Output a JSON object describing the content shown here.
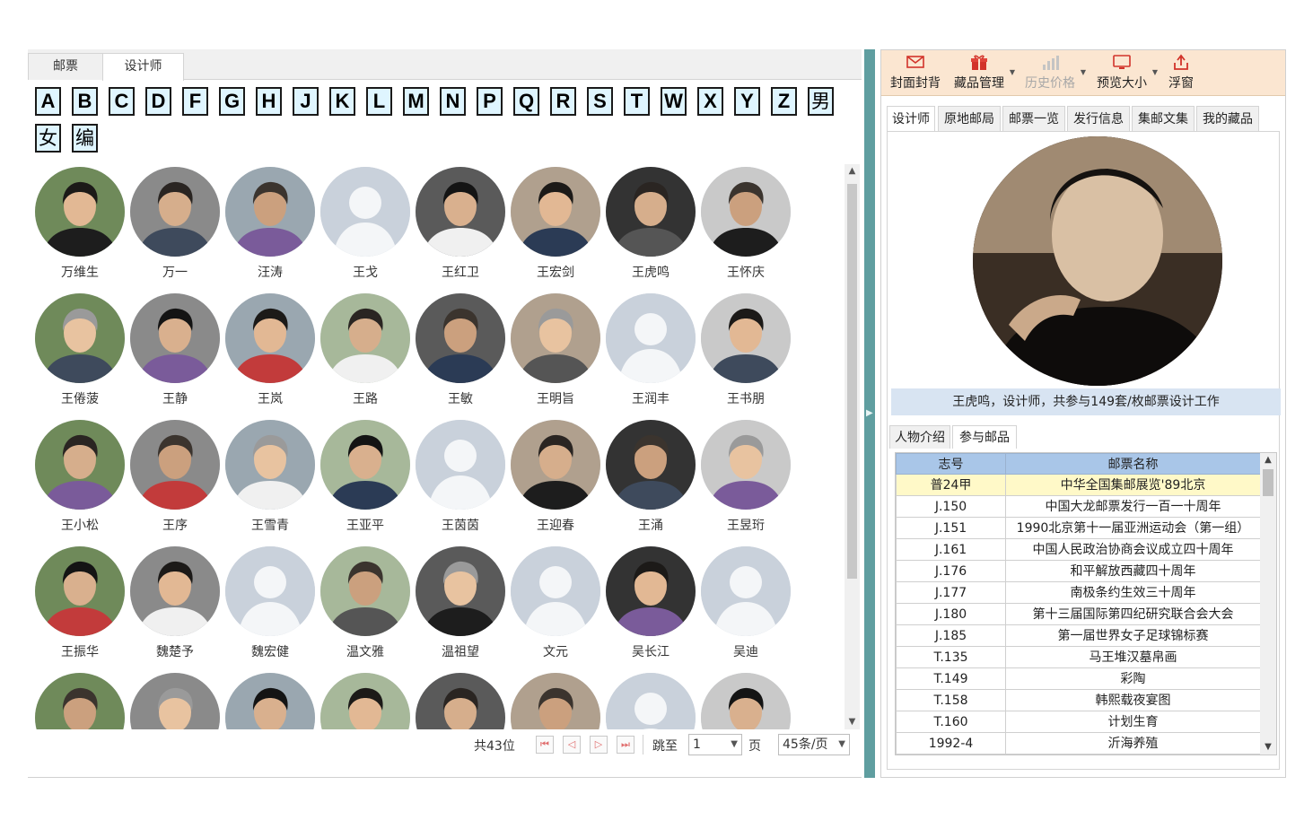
{
  "left_tabs": [
    {
      "label": "邮票"
    },
    {
      "label": "设计师"
    }
  ],
  "letters": [
    "A",
    "B",
    "C",
    "D",
    "F",
    "G",
    "H",
    "J",
    "K",
    "L",
    "M",
    "N",
    "P",
    "Q",
    "R",
    "S",
    "T",
    "W",
    "X",
    "Y",
    "Z",
    "男",
    "女",
    "编"
  ],
  "designers": [
    {
      "name": "万维生",
      "photo": true
    },
    {
      "name": "万一",
      "photo": true
    },
    {
      "name": "汪涛",
      "photo": true
    },
    {
      "name": "王戈",
      "photo": false
    },
    {
      "name": "王红卫",
      "photo": true
    },
    {
      "name": "王宏剑",
      "photo": true
    },
    {
      "name": "王虎鸣",
      "photo": true
    },
    {
      "name": "王怀庆",
      "photo": true
    },
    {
      "name": "王倦菠",
      "photo": true
    },
    {
      "name": "王静",
      "photo": true
    },
    {
      "name": "王岚",
      "photo": true
    },
    {
      "name": "王路",
      "photo": true
    },
    {
      "name": "王敏",
      "photo": true
    },
    {
      "name": "王明旨",
      "photo": true
    },
    {
      "name": "王润丰",
      "photo": false
    },
    {
      "name": "王书朋",
      "photo": true
    },
    {
      "name": "王小松",
      "photo": true
    },
    {
      "name": "王序",
      "photo": true
    },
    {
      "name": "王雪青",
      "photo": true
    },
    {
      "name": "王亚平",
      "photo": true
    },
    {
      "name": "王茵茵",
      "photo": false
    },
    {
      "name": "王迎春",
      "photo": true
    },
    {
      "name": "王涌",
      "photo": true
    },
    {
      "name": "王昱珩",
      "photo": true
    },
    {
      "name": "王振华",
      "photo": true
    },
    {
      "name": "魏楚予",
      "photo": true
    },
    {
      "name": "魏宏健",
      "photo": false
    },
    {
      "name": "温文雅",
      "photo": true
    },
    {
      "name": "温祖望",
      "photo": true
    },
    {
      "name": "文元",
      "photo": false
    },
    {
      "name": "吴长江",
      "photo": true
    },
    {
      "name": "吴迪",
      "photo": false
    },
    {
      "name": "",
      "photo": true
    },
    {
      "name": "",
      "photo": true
    },
    {
      "name": "",
      "photo": true
    },
    {
      "name": "",
      "photo": true
    },
    {
      "name": "",
      "photo": true
    },
    {
      "name": "",
      "photo": true
    },
    {
      "name": "",
      "photo": false
    },
    {
      "name": "",
      "photo": true
    }
  ],
  "pager": {
    "total": "共43位",
    "jump_label": "跳至",
    "page_value": "1",
    "page_unit": "页",
    "per_page": "45条/页"
  },
  "toolbar": [
    {
      "label": "封面封背",
      "icon": "envelope-icon",
      "enabled": true
    },
    {
      "label": "藏品管理",
      "icon": "gift-icon",
      "enabled": true
    },
    {
      "label": "历史价格",
      "icon": "bar-chart-icon",
      "enabled": false
    },
    {
      "label": "预览大小",
      "icon": "monitor-icon",
      "enabled": true
    },
    {
      "label": "浮窗",
      "icon": "share-icon",
      "enabled": true
    }
  ],
  "right_tabs": [
    {
      "label": "设计师"
    },
    {
      "label": "原地邮局"
    },
    {
      "label": "邮票一览"
    },
    {
      "label": "发行信息"
    },
    {
      "label": "集邮文集"
    },
    {
      "label": "我的藏品"
    }
  ],
  "selected": {
    "caption": "王虎鸣，设计师，共参与149套/枚邮票设计工作"
  },
  "sub_tabs": [
    {
      "label": "人物介绍"
    },
    {
      "label": "参与邮品"
    }
  ],
  "stamps_table": {
    "headers": [
      "志号",
      "邮票名称"
    ],
    "rows": [
      {
        "id": "普24甲",
        "name": "中华全国集邮展览'89北京"
      },
      {
        "id": "J.150",
        "name": "中国大龙邮票发行一百一十周年"
      },
      {
        "id": "J.151",
        "name": "1990北京第十一届亚洲运动会（第一组）"
      },
      {
        "id": "J.161",
        "name": "中国人民政治协商会议成立四十周年"
      },
      {
        "id": "J.176",
        "name": "和平解放西藏四十周年"
      },
      {
        "id": "J.177",
        "name": "南极条约生效三十周年"
      },
      {
        "id": "J.180",
        "name": "第十三届国际第四纪研究联合会大会"
      },
      {
        "id": "J.185",
        "name": "第一届世界女子足球锦标赛"
      },
      {
        "id": "T.135",
        "name": "马王堆汉墓帛画"
      },
      {
        "id": "T.149",
        "name": "彩陶"
      },
      {
        "id": "T.158",
        "name": "韩熙载夜宴图"
      },
      {
        "id": "T.160",
        "name": "计划生育"
      },
      {
        "id": "1992-4",
        "name": "沂海养殖"
      }
    ]
  },
  "colors": {
    "accent": "#5f9ea0",
    "letter_bg": "#dff5ff",
    "toolbar_bg": "#fbe6d1",
    "caption_bg": "#d8e4f2",
    "header_bg": "#a9c6e8",
    "row_highlight": "#fff9c8"
  }
}
